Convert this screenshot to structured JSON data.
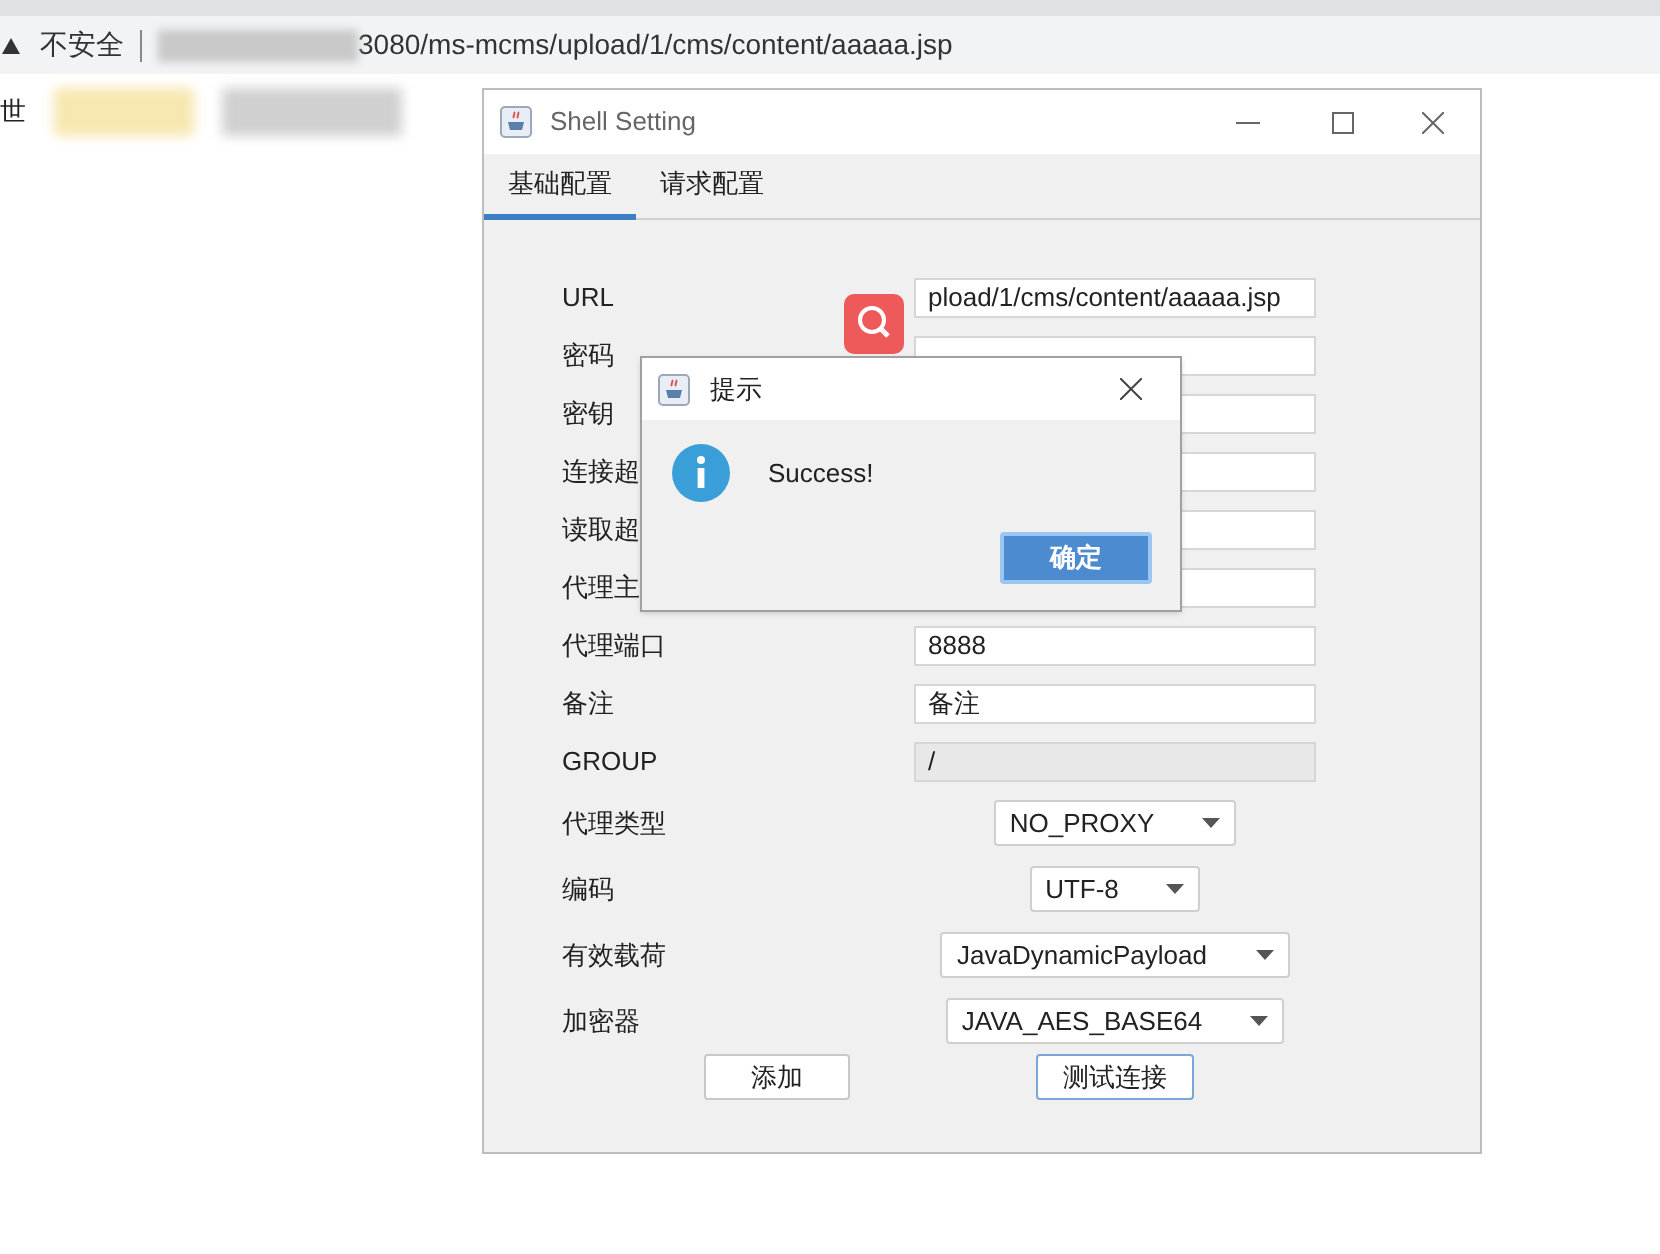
{
  "browser": {
    "security_label": "不安全",
    "url": "3080/ms-mcms/upload/1/cms/content/aaaaa.jsp",
    "bookmark_text": "世"
  },
  "window": {
    "title": "Shell Setting",
    "tabs": [
      {
        "label": "基础配置",
        "selected": true
      },
      {
        "label": "请求配置",
        "selected": false
      }
    ],
    "fields": [
      {
        "label": "URL",
        "value": "pload/1/cms/content/aaaaa.jsp",
        "disabled": false
      },
      {
        "label": "密码",
        "disabled": false
      },
      {
        "label": "密钥",
        "disabled": false
      },
      {
        "label": "连接超",
        "disabled": false
      },
      {
        "label": "读取超",
        "disabled": false
      },
      {
        "label": "代理主",
        "disabled": false
      },
      {
        "label": "代理端口",
        "value": "8888",
        "disabled": false
      },
      {
        "label": "备注",
        "value": "备注",
        "disabled": false
      },
      {
        "label": "GROUP",
        "value": "/",
        "disabled": true
      }
    ],
    "selects": [
      {
        "label": "代理类型",
        "value": "NO_PROXY"
      },
      {
        "label": "编码",
        "value": "UTF-8"
      },
      {
        "label": "有效载荷",
        "value": "JavaDynamicPayload"
      },
      {
        "label": "加密器",
        "value": "JAVA_AES_BASE64"
      }
    ],
    "buttons": [
      {
        "label": "添加",
        "focused": false
      },
      {
        "label": "测试连接",
        "focused": true
      }
    ]
  },
  "dialog": {
    "title": "提示",
    "message": "Success!",
    "button": "确定"
  }
}
